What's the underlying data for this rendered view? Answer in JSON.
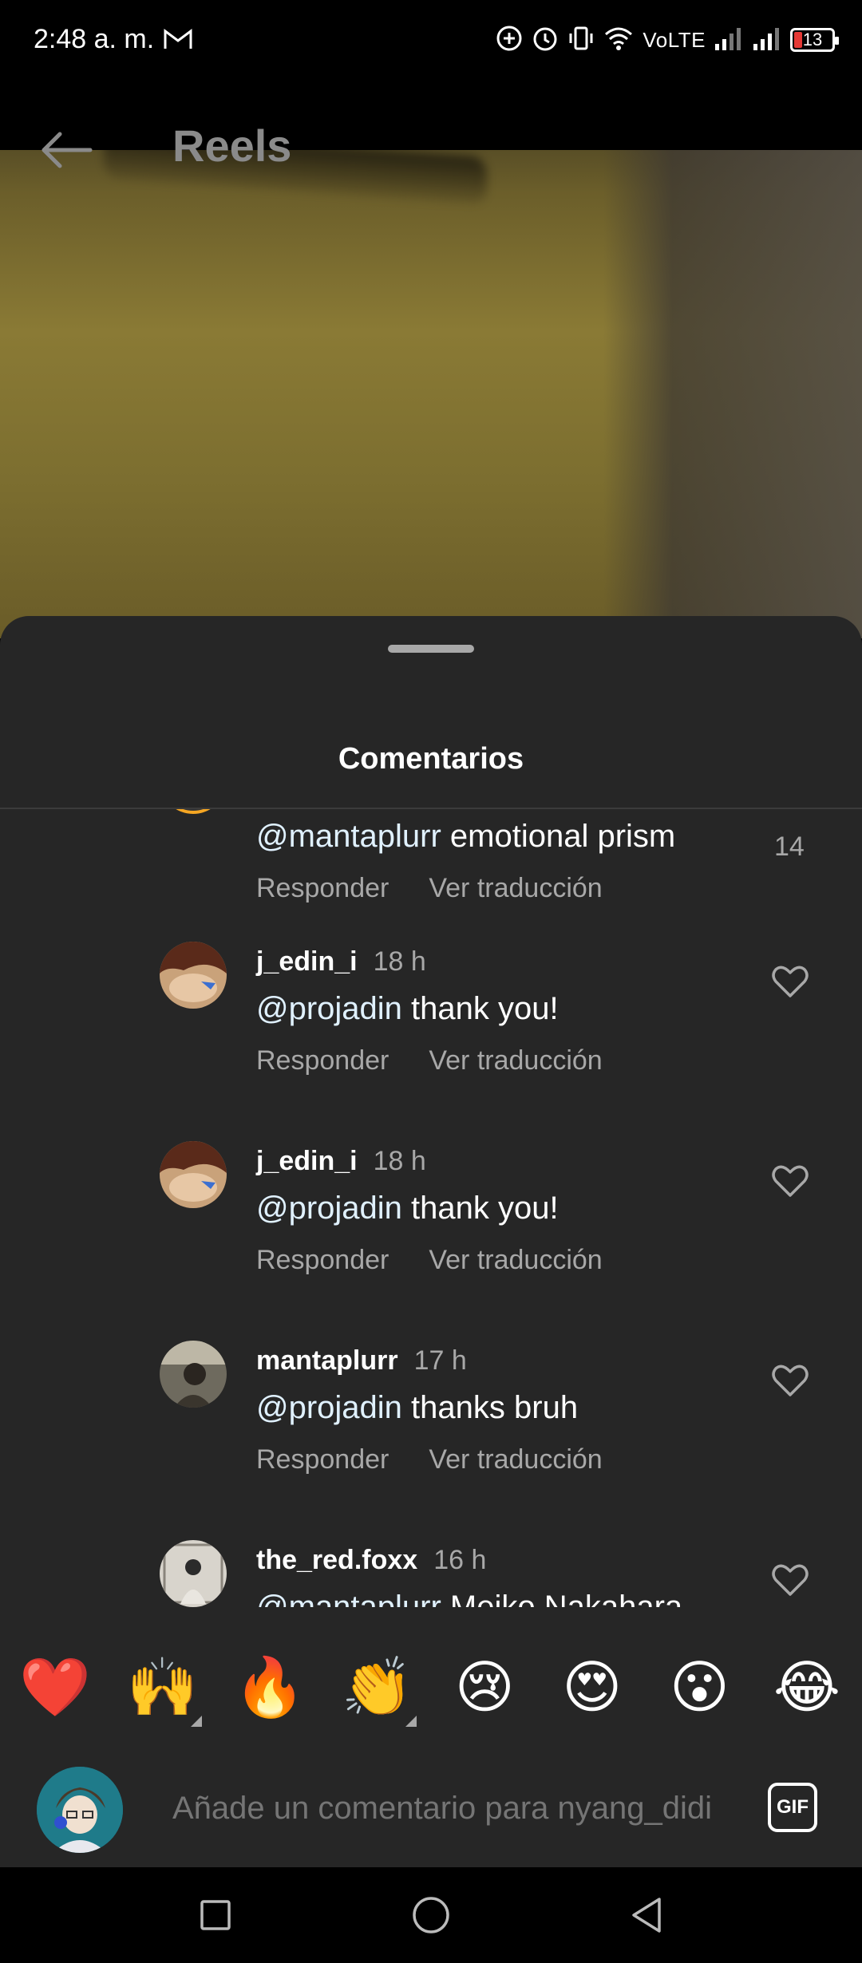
{
  "status_bar": {
    "time": "2:48 a. m.",
    "network": "VoLTE",
    "battery": "13",
    "battery_color": "#e53935"
  },
  "header": {
    "title": "Reels",
    "back_icon": "arrow-left-icon"
  },
  "comments_sheet": {
    "title": "Comentarios",
    "reply_label": "Responder",
    "translate_label": "Ver traducción",
    "comments": [
      {
        "user": "",
        "time": "",
        "mention": "@mantaplurr",
        "text": " emotional prism",
        "likes": "14"
      },
      {
        "user": "j_edin_i",
        "time": "18 h",
        "mention": "@projadin",
        "text": " thank you!",
        "likes": ""
      },
      {
        "user": "j_edin_i",
        "time": "18 h",
        "mention": "@projadin",
        "text": " thank you!",
        "likes": ""
      },
      {
        "user": "mantaplurr",
        "time": "17 h",
        "mention": "@projadin",
        "text": " thanks bruh",
        "likes": ""
      },
      {
        "user": "the_red.foxx",
        "time": "16 h",
        "mention": "@mantaplurr",
        "text": " Meiko Nakahara",
        "likes": ""
      }
    ]
  },
  "emoji_bar": [
    "❤️",
    "🙌",
    "🔥",
    "👏",
    "😢",
    "😍",
    "😮",
    "😂"
  ],
  "input": {
    "placeholder": "Añade un comentario para nyang_didi",
    "gif_label": "GIF"
  },
  "nav_bar": {
    "icons": [
      "recents-square-icon",
      "home-circle-icon",
      "back-triangle-icon"
    ]
  }
}
